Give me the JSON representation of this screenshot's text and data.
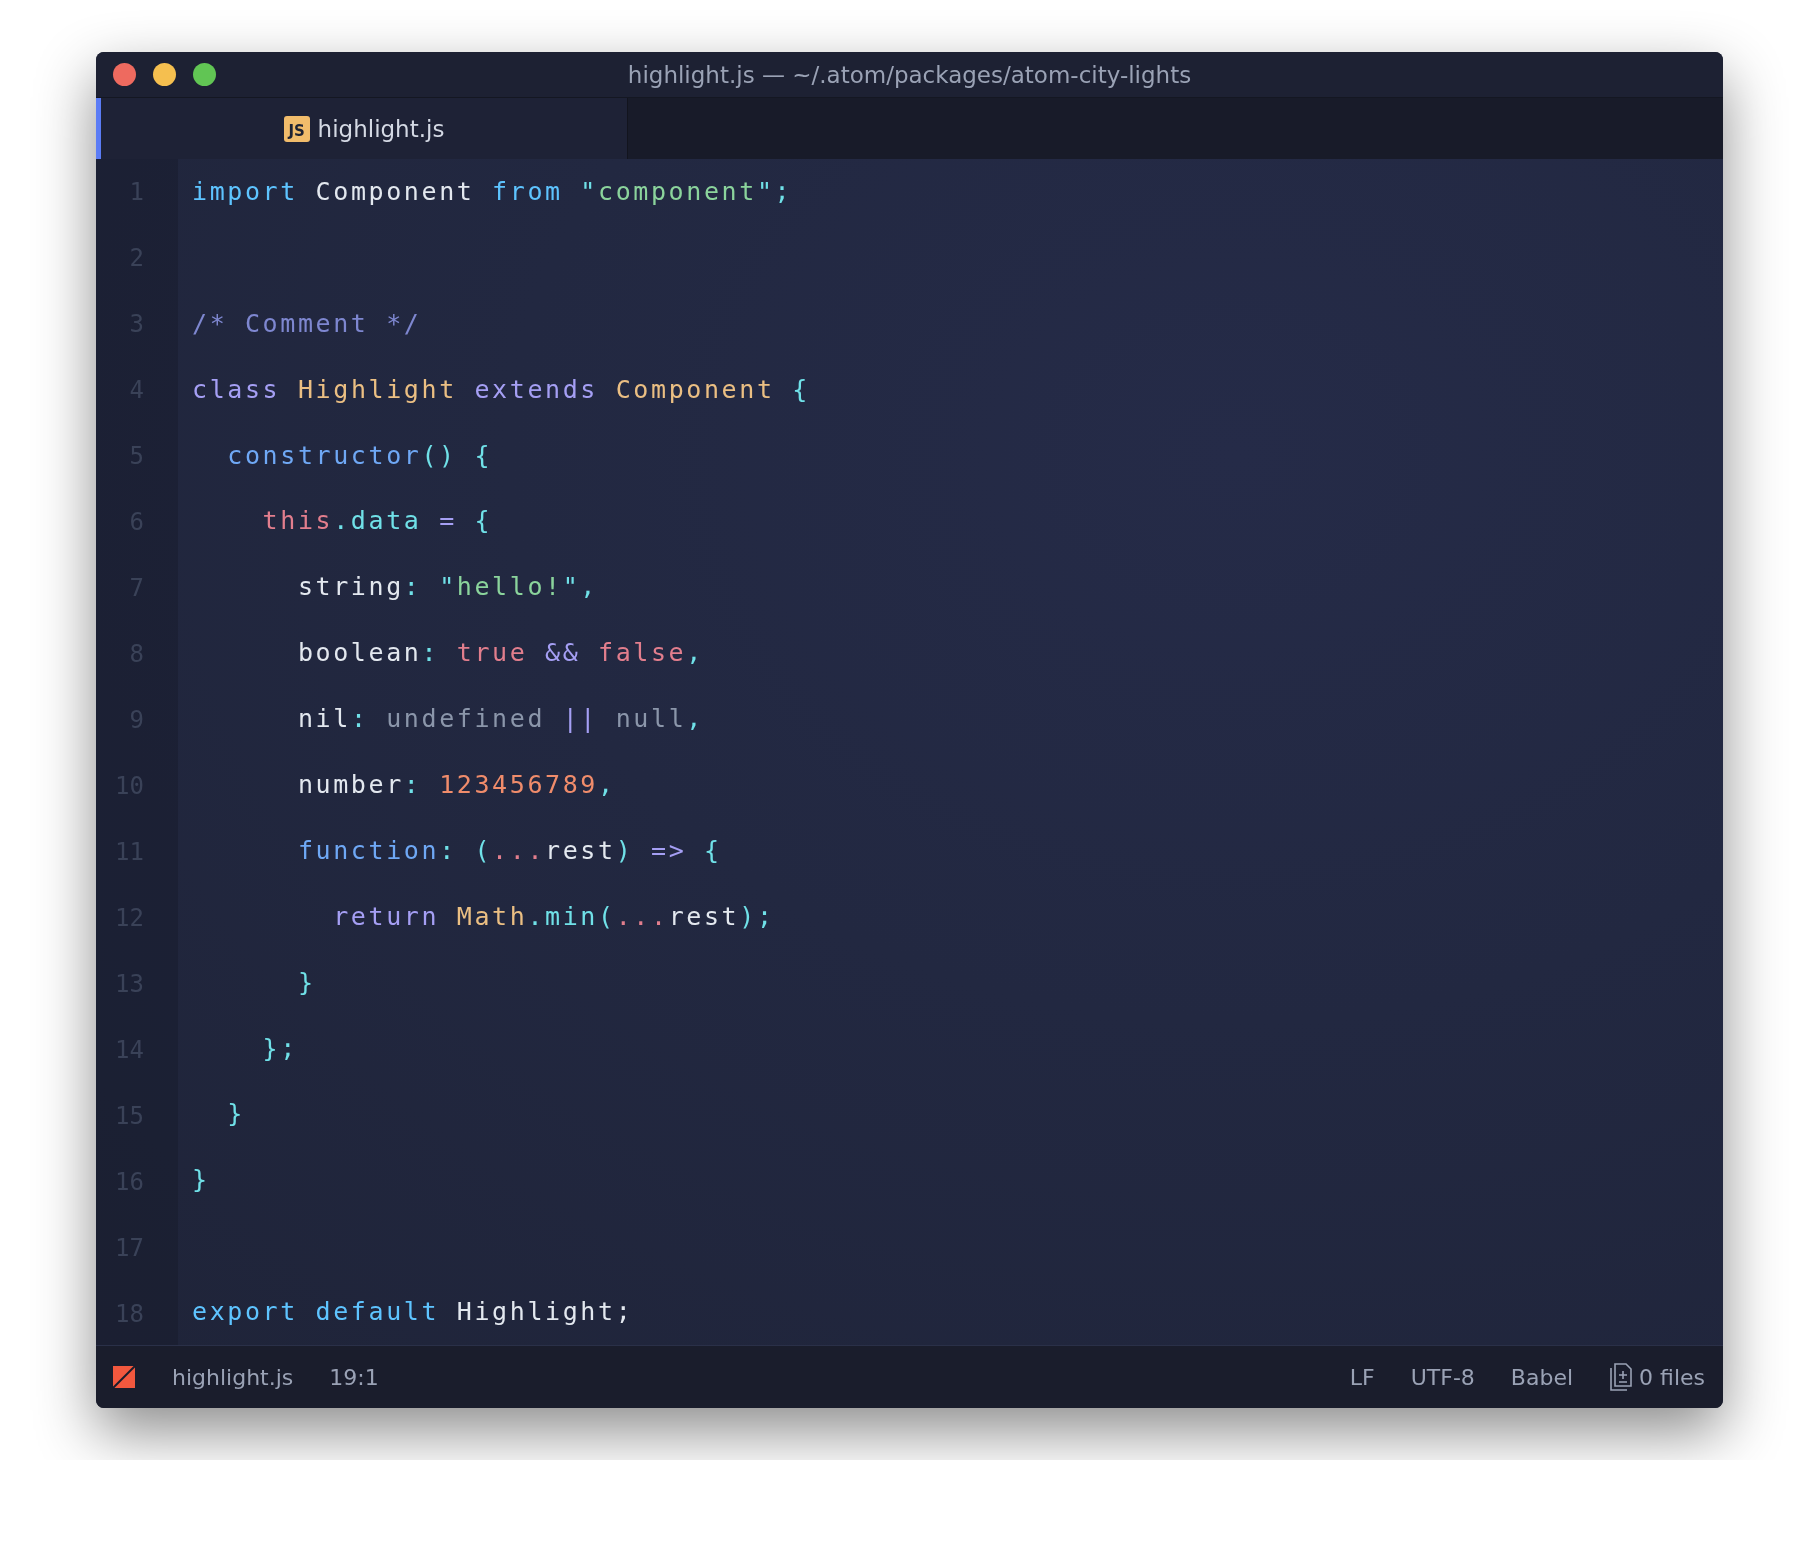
{
  "window": {
    "title": "highlight.js — ~/.atom/packages/atom-city-lights"
  },
  "tabs": [
    {
      "label": "highlight.js",
      "icon_text": "JS",
      "selected": true
    }
  ],
  "editor": {
    "lines": [
      {
        "number": "1",
        "tokens": [
          {
            "kind": "keyword",
            "text": "import"
          },
          {
            "kind": "plain",
            "text": " Component "
          },
          {
            "kind": "keyword",
            "text": "from"
          },
          {
            "kind": "punct",
            "text": " \""
          },
          {
            "kind": "string",
            "text": "component"
          },
          {
            "kind": "punct",
            "text": "\";"
          }
        ]
      },
      {
        "number": "2"
      },
      {
        "number": "3",
        "tokens": [
          {
            "kind": "comment",
            "text": "/* Comment */"
          }
        ]
      },
      {
        "number": "4",
        "tokens": [
          {
            "kind": "storage",
            "text": "class "
          },
          {
            "kind": "type",
            "text": "Highlight"
          },
          {
            "kind": "storage",
            "text": " extends "
          },
          {
            "kind": "type",
            "text": "Component"
          },
          {
            "kind": "punct",
            "text": " {"
          }
        ]
      },
      {
        "number": "5",
        "tokens": [
          {
            "kind": "func",
            "text": "  constructor"
          },
          {
            "kind": "punct",
            "text": "() {"
          }
        ]
      },
      {
        "number": "6",
        "tokens": [
          {
            "kind": "this",
            "text": "    this"
          },
          {
            "kind": "punct",
            "text": ".data"
          },
          {
            "kind": "op",
            "text": " = "
          },
          {
            "kind": "punct",
            "text": "{"
          }
        ]
      },
      {
        "number": "7",
        "tokens": [
          {
            "kind": "plain",
            "text": "      string"
          },
          {
            "kind": "punct",
            "text": ": \""
          },
          {
            "kind": "string",
            "text": "hello!"
          },
          {
            "kind": "punct",
            "text": "\","
          }
        ]
      },
      {
        "number": "8",
        "tokens": [
          {
            "kind": "plain",
            "text": "      boolean"
          },
          {
            "kind": "punct",
            "text": ": "
          },
          {
            "kind": "bool",
            "text": "true"
          },
          {
            "kind": "op",
            "text": " && "
          },
          {
            "kind": "bool",
            "text": "false"
          },
          {
            "kind": "punct",
            "text": ","
          }
        ]
      },
      {
        "number": "9",
        "tokens": [
          {
            "kind": "plain",
            "text": "      nil"
          },
          {
            "kind": "punct",
            "text": ": "
          },
          {
            "kind": "null",
            "text": "undefined"
          },
          {
            "kind": "op",
            "text": " || "
          },
          {
            "kind": "null",
            "text": "null"
          },
          {
            "kind": "punct",
            "text": ","
          }
        ]
      },
      {
        "number": "10",
        "tokens": [
          {
            "kind": "plain",
            "text": "      number"
          },
          {
            "kind": "punct",
            "text": ": "
          },
          {
            "kind": "number",
            "text": "123456789"
          },
          {
            "kind": "punct",
            "text": ","
          }
        ]
      },
      {
        "number": "11",
        "tokens": [
          {
            "kind": "func",
            "text": "      function"
          },
          {
            "kind": "punct",
            "text": ": ("
          },
          {
            "kind": "spread",
            "text": "..."
          },
          {
            "kind": "plain",
            "text": "rest"
          },
          {
            "kind": "punct",
            "text": ") "
          },
          {
            "kind": "op",
            "text": "=>"
          },
          {
            "kind": "punct",
            "text": " {"
          }
        ]
      },
      {
        "number": "12",
        "tokens": [
          {
            "kind": "storage",
            "text": "        return "
          },
          {
            "kind": "type",
            "text": "Math"
          },
          {
            "kind": "punct",
            "text": ".min("
          },
          {
            "kind": "spread",
            "text": "..."
          },
          {
            "kind": "plain",
            "text": "rest"
          },
          {
            "kind": "punct",
            "text": ");"
          }
        ]
      },
      {
        "number": "13",
        "tokens": [
          {
            "kind": "punct",
            "text": "      }"
          }
        ]
      },
      {
        "number": "14",
        "tokens": [
          {
            "kind": "punct",
            "text": "    };"
          }
        ]
      },
      {
        "number": "15",
        "tokens": [
          {
            "kind": "punct",
            "text": "  }"
          }
        ]
      },
      {
        "number": "16",
        "tokens": [
          {
            "kind": "punct",
            "text": "}"
          }
        ]
      },
      {
        "number": "17"
      },
      {
        "number": "18",
        "tokens": [
          {
            "kind": "keyword",
            "text": "export default"
          },
          {
            "kind": "plain",
            "text": " Highlight;"
          }
        ]
      }
    ]
  },
  "status_bar": {
    "file": "highlight.js",
    "cursor": "19:1",
    "line_ending": "LF",
    "encoding": "UTF-8",
    "grammar": "Babel",
    "files": "0 files"
  }
}
